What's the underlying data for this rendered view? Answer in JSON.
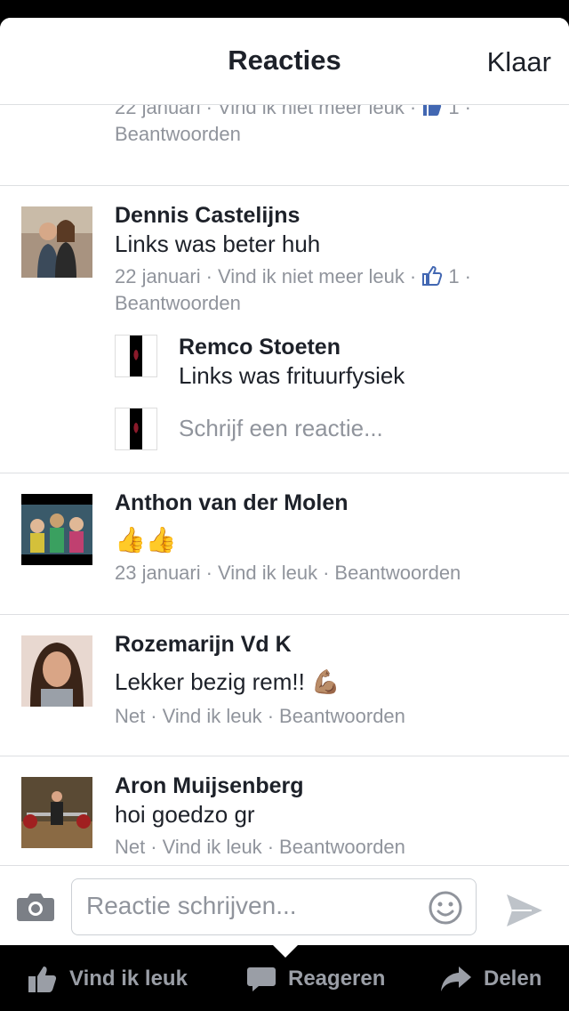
{
  "header": {
    "title": "Reacties",
    "done_label": "Klaar"
  },
  "partial_comment": {
    "date": "22 januari",
    "like_action": "Vind ik niet meer leuk",
    "like_count": "1",
    "reply_action": "Beantwoorden"
  },
  "comments": [
    {
      "name": "Dennis Castelijns",
      "text": "Links was beter huh",
      "date": "22 januari",
      "like_action": "Vind ik niet meer leuk",
      "like_count": "1",
      "reply_action": "Beantwoorden",
      "replies": [
        {
          "name": "Remco Stoeten",
          "text": "Links was frituurfysiek"
        }
      ],
      "reply_placeholder": "Schrijf een reactie..."
    },
    {
      "name": "Anthon van der Molen",
      "text": "👍👍",
      "date": "23 januari",
      "like_action": "Vind ik leuk",
      "reply_action": "Beantwoorden"
    },
    {
      "name": "Rozemarijn Vd K",
      "text": "Lekker bezig rem!! 💪🏽",
      "date": "Net",
      "like_action": "Vind ik leuk",
      "reply_action": "Beantwoorden"
    },
    {
      "name": "Aron Muijsenberg",
      "text": "hoi goedzo gr",
      "date": "Net",
      "like_action": "Vind ik leuk",
      "reply_action": "Beantwoorden"
    }
  ],
  "composer": {
    "placeholder": "Reactie schrijven..."
  },
  "actions": {
    "like": "Vind ik leuk",
    "comment": "Reageren",
    "share": "Delen"
  },
  "colors": {
    "brand_blue": "#4267b2",
    "meta_gray": "#90949c",
    "text": "#1d2129"
  },
  "icons": {
    "like": "thumbs-up-icon",
    "camera": "camera-icon",
    "emoji": "smiley-icon",
    "send": "send-icon",
    "comment": "speech-bubble-icon",
    "share": "share-arrow-icon"
  }
}
